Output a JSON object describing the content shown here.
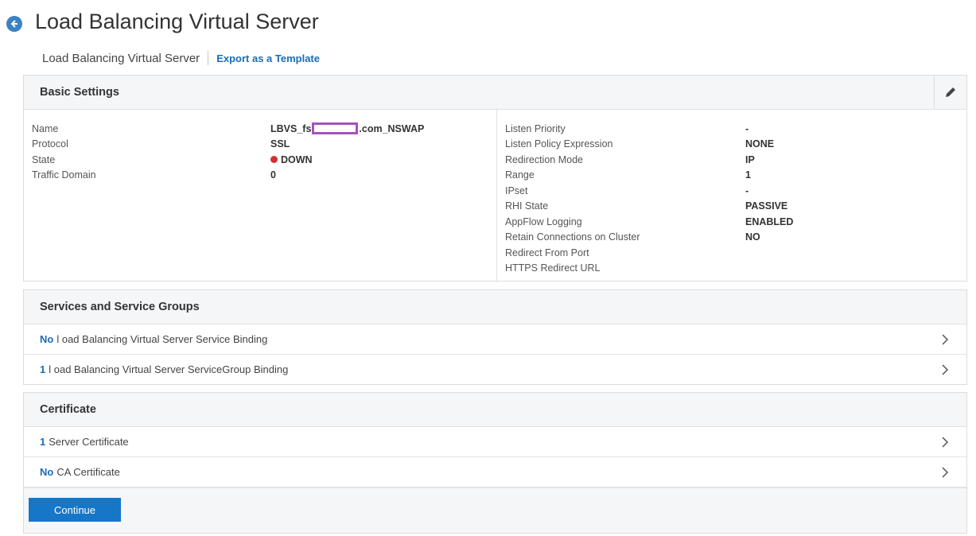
{
  "header": {
    "title": "Load Balancing Virtual Server"
  },
  "breadcrumb": {
    "title": "Load Balancing Virtual Server",
    "export_link": "Export as a Template"
  },
  "basic_settings": {
    "title": "Basic Settings",
    "left": [
      {
        "key": "Name",
        "value_prefix": "LBVS_fs",
        "value_suffix": ".com_NSWAP"
      },
      {
        "key": "Protocol",
        "value": "SSL"
      },
      {
        "key": "State",
        "value": "DOWN",
        "status_color": "#d22f2f"
      },
      {
        "key": "Traffic Domain",
        "value": "0"
      }
    ],
    "right": [
      {
        "key": "Listen Priority",
        "value": "-"
      },
      {
        "key": "Listen Policy Expression",
        "value": "NONE"
      },
      {
        "key": "Redirection Mode",
        "value": "IP"
      },
      {
        "key": "Range",
        "value": "1"
      },
      {
        "key": "IPset",
        "value": "-"
      },
      {
        "key": "RHI State",
        "value": "PASSIVE"
      },
      {
        "key": "AppFlow Logging",
        "value": "ENABLED"
      },
      {
        "key": "Retain Connections on Cluster",
        "value": "NO"
      },
      {
        "key": "Redirect From Port",
        "value": ""
      },
      {
        "key": "HTTPS Redirect URL",
        "value": ""
      }
    ]
  },
  "services": {
    "title": "Services and Service Groups",
    "rows": [
      {
        "count": "No",
        "label": "l oad Balancing Virtual Server Service Binding"
      },
      {
        "count": "1",
        "label": "l oad Balancing Virtual Server ServiceGroup Binding"
      }
    ]
  },
  "certificate": {
    "title": "Certificate",
    "rows": [
      {
        "count": "1",
        "label": "Server Certificate"
      },
      {
        "count": "No",
        "label": "CA Certificate"
      }
    ]
  },
  "actions": {
    "continue_label": "Continue"
  },
  "colors": {
    "accent": "#1677c9",
    "link": "#1a6db5",
    "redaction": "#a353b8"
  }
}
